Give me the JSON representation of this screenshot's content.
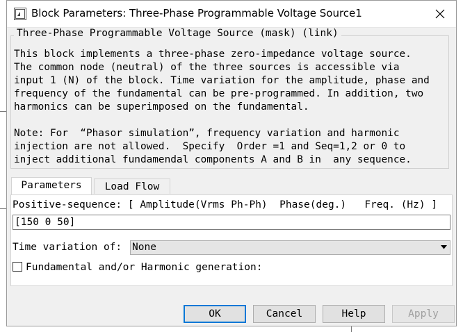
{
  "window": {
    "title": "Block Parameters: Three-Phase Programmable Voltage Source1",
    "icons": {
      "app": "simulink-block-icon",
      "close": "close-icon"
    }
  },
  "mask": {
    "title": "Three-Phase Programmable Voltage Source (mask) (link)",
    "description": "This block implements a three-phase zero-impedance voltage source.\nThe common node (neutral) of the three sources is accessible via\ninput 1 (N) of the block. Time variation for the amplitude, phase and\nfrequency of the fundamental can be pre-programmed. In addition, two\nharmonics can be superimposed on the fundamental.",
    "note": "Note: For  “Phasor simulation”, frequency variation and harmonic\ninjection are not allowed.  Specify  Order =1 and Seq=1,2 or 0 to\ninject additional fundamendal components A and B in  any sequence."
  },
  "tabs": [
    {
      "label": "Parameters",
      "active": true
    },
    {
      "label": "Load Flow",
      "active": false
    }
  ],
  "parameters": {
    "positive_sequence_label": "Positive-sequence: [ Amplitude(Vrms Ph-Ph)  Phase(deg.)   Freq. (Hz) ]",
    "positive_sequence_value": "[150  0 50]",
    "time_variation_label": "Time variation of:",
    "time_variation_value": "None",
    "harmonic_label": "Fundamental and/or Harmonic generation:",
    "harmonic_checked": false
  },
  "buttons": {
    "ok": "OK",
    "cancel": "Cancel",
    "help": "Help",
    "apply": "Apply"
  }
}
